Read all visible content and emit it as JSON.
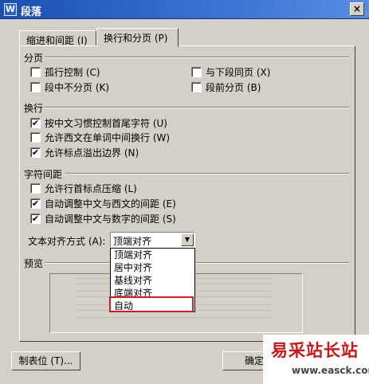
{
  "window": {
    "title": "段落",
    "app_icon_letter": "W",
    "close_label": "×"
  },
  "tabs": [
    {
      "label": "缩进和间距 (I)",
      "active": false
    },
    {
      "label": "换行和分页 (P)",
      "active": true
    }
  ],
  "pagination": {
    "header": "分页",
    "widow_control": {
      "label": "孤行控制 (C)",
      "checked": false
    },
    "keep_with_next": {
      "label": "与下段同页 (X)",
      "checked": false
    },
    "keep_lines_together": {
      "label": "段中不分页 (K)",
      "checked": false
    },
    "page_break_before": {
      "label": "段前分页 (B)",
      "checked": false
    }
  },
  "line_breaking": {
    "header": "换行",
    "chinese_rules": {
      "label": "按中文习惯控制首尾字符 (U)",
      "checked": true
    },
    "allow_latin_wrap": {
      "label": "允许西文在单词中间换行 (W)",
      "checked": false
    },
    "allow_punct_overflow": {
      "label": "允许标点溢出边界 (N)",
      "checked": true
    }
  },
  "char_spacing": {
    "header": "字符间距",
    "compress_punct": {
      "label": "允许行首标点压缩 (L)",
      "checked": false
    },
    "auto_cn_latin": {
      "label": "自动调整中文与西文的间距 (E)",
      "checked": true
    },
    "auto_cn_digit": {
      "label": "自动调整中文与数字的间距 (S)",
      "checked": true
    }
  },
  "text_alignment": {
    "label": "文本对齐方式 (A):",
    "selected": "顶端对齐",
    "options": [
      "顶端对齐",
      "居中对齐",
      "基线对齐",
      "底端对齐",
      "自动"
    ],
    "highlighted_option": "自动"
  },
  "preview": {
    "header": "预览"
  },
  "buttons": {
    "tabs": "制表位 (T)...",
    "ok": "确定"
  },
  "check_mark": "✔",
  "dropdown_arrow": "▼",
  "watermark": {
    "text": "易采站长站",
    "url": "www.easck.com"
  },
  "colors": {
    "titlebar": "#1c4fb2",
    "highlight_border": "#cc2020",
    "watermark_text": "#c81818"
  }
}
